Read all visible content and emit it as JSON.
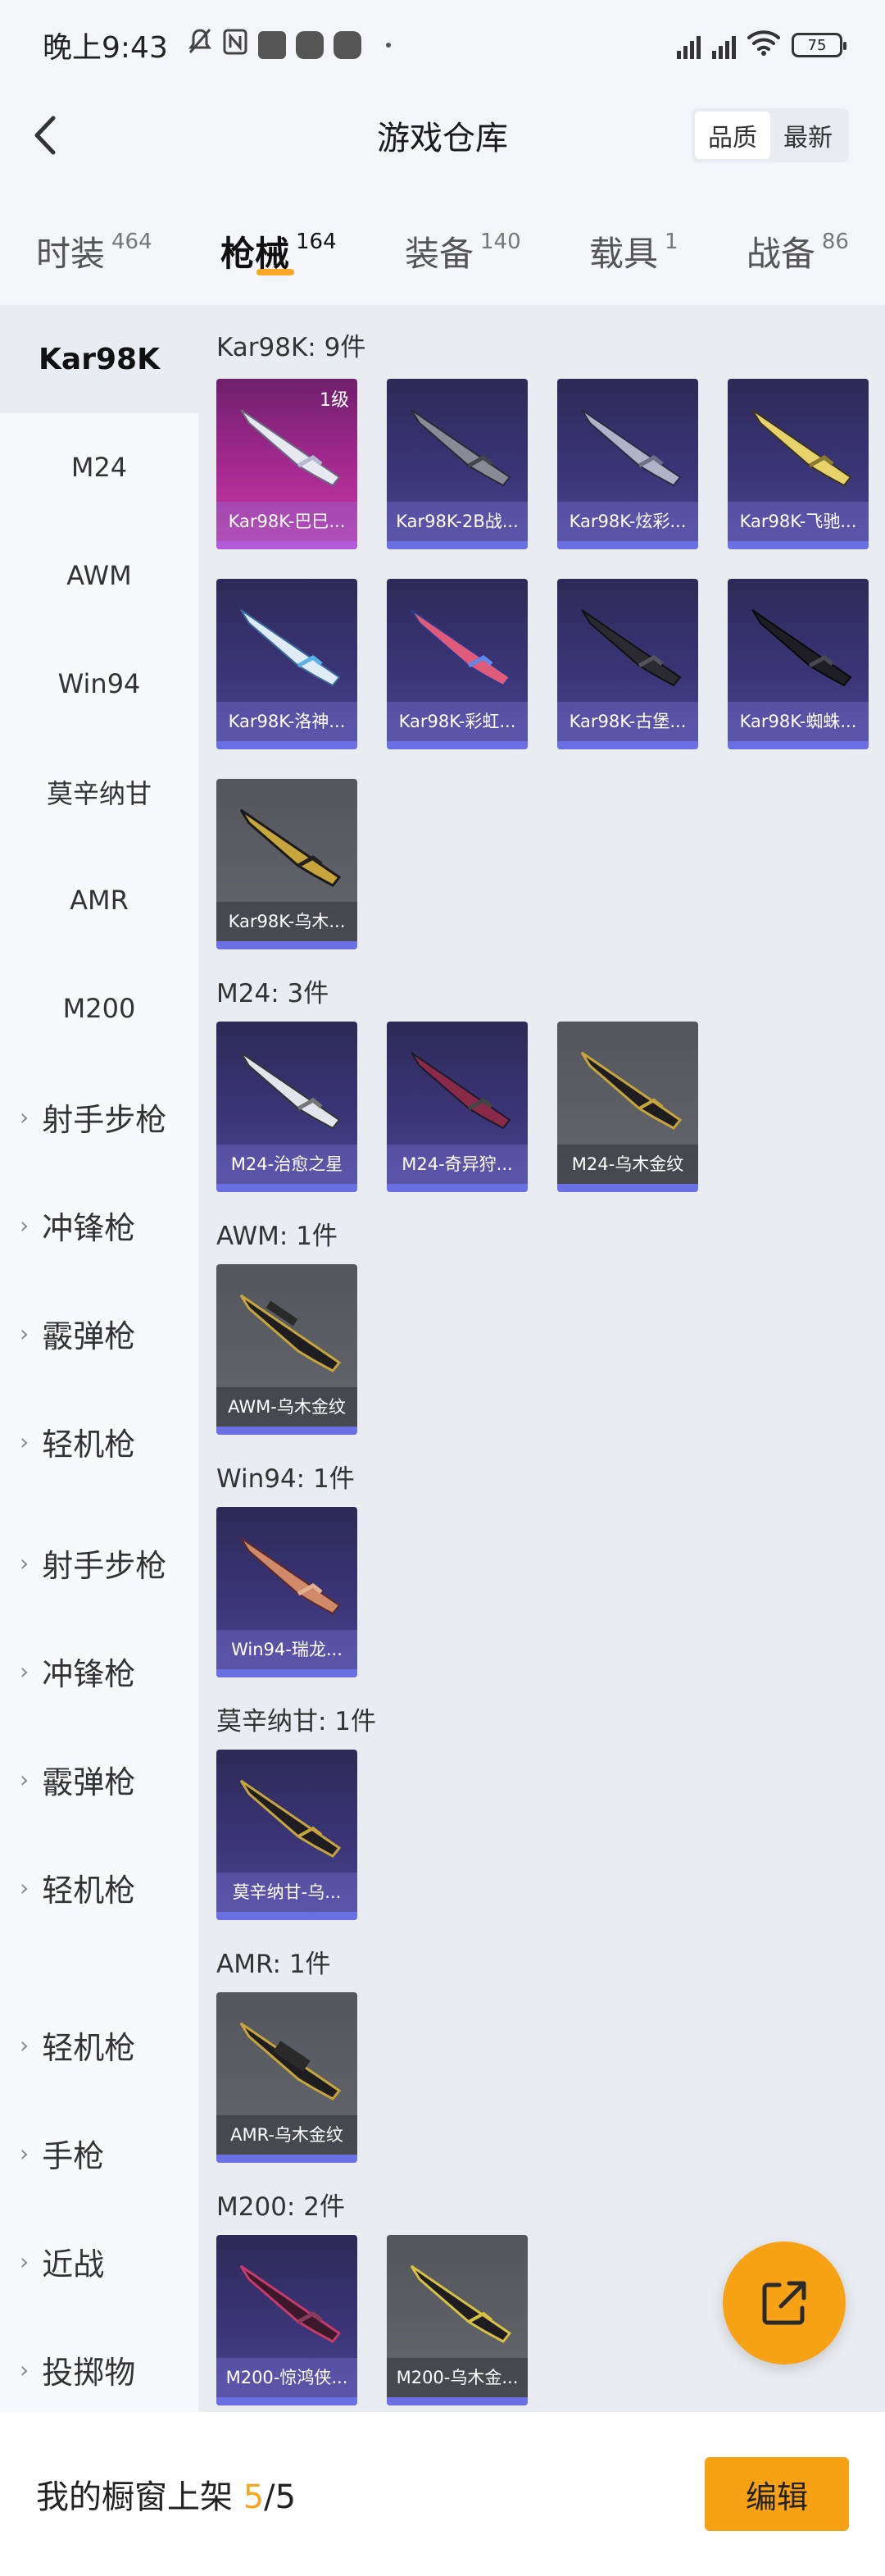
{
  "status_bar": {
    "time": "晚上9:43",
    "battery": "75"
  },
  "header": {
    "title": "游戏仓库",
    "sort_options": [
      "品质",
      "最新"
    ]
  },
  "tabs": [
    {
      "label": "时装",
      "count": "464"
    },
    {
      "label": "枪械",
      "count": "164"
    },
    {
      "label": "装备",
      "count": "140"
    },
    {
      "label": "载具",
      "count": "1"
    },
    {
      "label": "战备",
      "count": "86"
    }
  ],
  "sidebar": {
    "items": [
      "Kar98K",
      "M24",
      "AWM",
      "Win94",
      "莫辛纳甘",
      "AMR",
      "M200"
    ],
    "groups": [
      "射手步枪",
      "冲锋枪",
      "霰弹枪",
      "轻机枪",
      "射手步枪",
      "冲锋枪",
      "霰弹枪",
      "轻机枪",
      "轻机枪",
      "手枪",
      "近战",
      "投掷物"
    ]
  },
  "sections": [
    {
      "title": "Kar98K: 9件",
      "items": [
        {
          "name": "Kar98K-巴巳...",
          "level": "1级"
        },
        {
          "name": "Kar98K-2B战..."
        },
        {
          "name": "Kar98K-炫彩..."
        },
        {
          "name": "Kar98K-飞驰..."
        },
        {
          "name": "Kar98K-洛神..."
        },
        {
          "name": "Kar98K-彩虹..."
        },
        {
          "name": "Kar98K-古堡..."
        },
        {
          "name": "Kar98K-蜘蛛..."
        },
        {
          "name": "Kar98K-乌木..."
        }
      ]
    },
    {
      "title": "M24: 3件",
      "items": [
        {
          "name": "M24-治愈之星"
        },
        {
          "name": "M24-奇异狩..."
        },
        {
          "name": "M24-乌木金纹"
        }
      ]
    },
    {
      "title": "AWM: 1件",
      "items": [
        {
          "name": "AWM-乌木金纹"
        }
      ]
    },
    {
      "title": "Win94: 1件",
      "items": [
        {
          "name": "Win94-瑞龙..."
        }
      ]
    },
    {
      "title": "莫辛纳甘: 1件",
      "items": [
        {
          "name": "莫辛纳甘-乌..."
        }
      ]
    },
    {
      "title": "AMR: 1件",
      "items": [
        {
          "name": "AMR-乌木金纹"
        }
      ]
    },
    {
      "title": "M200: 2件",
      "items": [
        {
          "name": "M200-惊鸿侠..."
        },
        {
          "name": "M200-乌木金..."
        }
      ]
    }
  ],
  "bottom_bar": {
    "showcase_label": "我的橱窗上架",
    "showcase_current": "5",
    "showcase_total": "/5",
    "edit_label": "编辑"
  },
  "colors": {
    "accent": "#f7a215",
    "tab_underline": "#f5a623"
  }
}
